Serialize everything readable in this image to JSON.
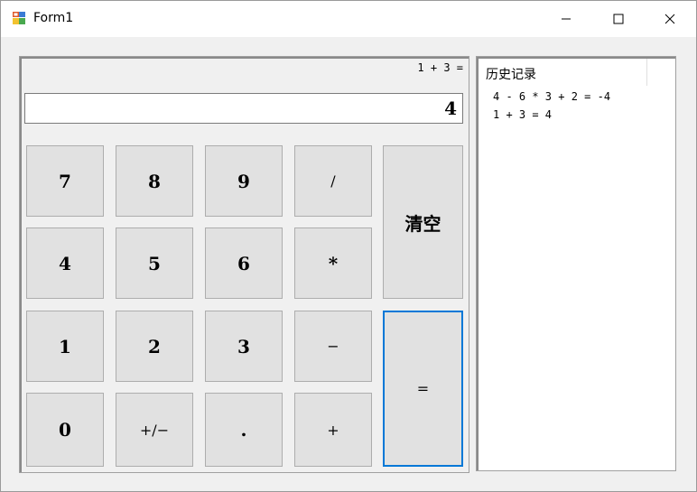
{
  "window": {
    "title": "Form1",
    "icon": "winforms-app-icon",
    "controls": {
      "minimize": "minimize-icon",
      "maximize": "maximize-icon",
      "close": "close-icon"
    }
  },
  "calculator": {
    "expression": "1 + 3 =",
    "display_value": "4",
    "keys": {
      "k7": "7",
      "k8": "8",
      "k9": "9",
      "div": "/",
      "k4": "4",
      "k5": "5",
      "k6": "6",
      "mul": "*",
      "k1": "1",
      "k2": "2",
      "k3": "3",
      "sub": "−",
      "k0": "0",
      "neg": "+/−",
      "dot": ".",
      "add": "+",
      "clear": "清空",
      "equals": "="
    }
  },
  "history": {
    "title": "历史记录",
    "items": [
      "4 - 6 * 3 + 2 = -4",
      "1 + 3 = 4"
    ]
  },
  "colors": {
    "focus_border": "#0078d7",
    "button_face": "#e1e1e1",
    "window_bg": "#f0f0f0"
  }
}
